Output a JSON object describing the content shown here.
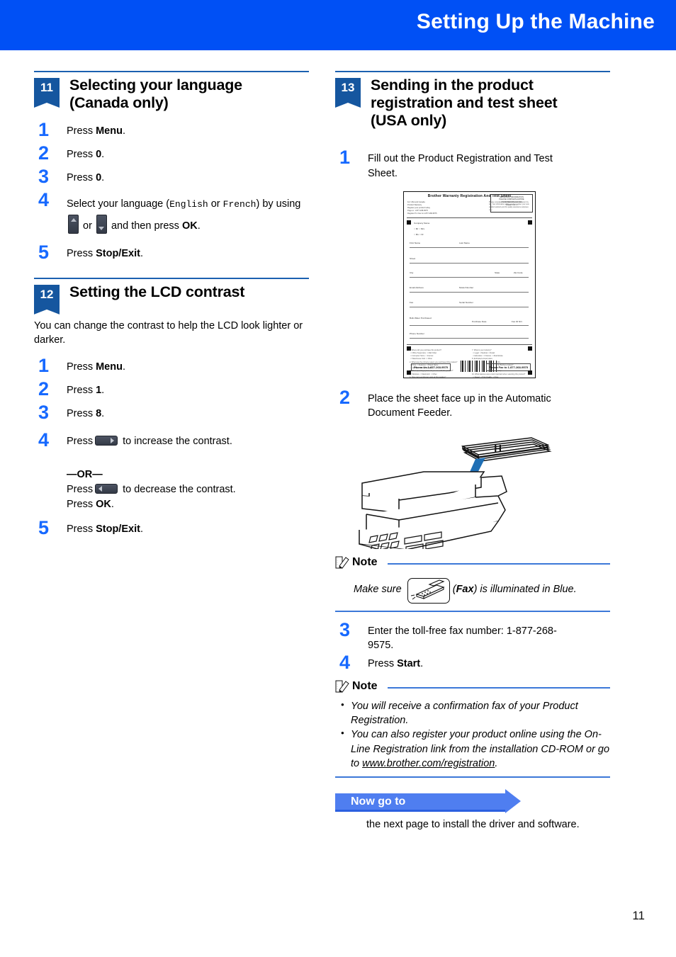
{
  "header": {
    "title": "Setting Up the Machine"
  },
  "page_number": "11",
  "left_column": {
    "sections": [
      {
        "number": "11",
        "title_line1": "Selecting your language",
        "title_line2": "(Canada only)",
        "steps": [
          {
            "num": "1",
            "text_before": "Press ",
            "bold": "Menu",
            "text_after": "."
          },
          {
            "num": "2",
            "text_before": "Press ",
            "bold": "0",
            "text_after": "."
          },
          {
            "num": "3",
            "text_before": "Press ",
            "bold": "0",
            "text_after": "."
          },
          {
            "num": "4",
            "part1": "Select your language (",
            "mono1": "English",
            "part2": " or ",
            "mono2": "French",
            "part3": ") by using ",
            "icon_up": "up-arrow-key",
            "part4": " or ",
            "icon_down": "down-arrow-key",
            "part5": " and then press ",
            "bold": "OK",
            "part6": "."
          },
          {
            "num": "5",
            "text_before": "Press ",
            "bold": "Stop/Exit",
            "text_after": "."
          }
        ]
      },
      {
        "number": "12",
        "title_line1": "Setting the LCD contrast",
        "title_line2": "",
        "intro": "You can change the contrast to help the LCD look lighter or darker.",
        "steps": [
          {
            "num": "1",
            "text_before": "Press ",
            "bold": "Menu",
            "text_after": "."
          },
          {
            "num": "2",
            "text_before": "Press ",
            "bold": "1",
            "text_after": "."
          },
          {
            "num": "3",
            "text_before": "Press ",
            "bold": "8",
            "text_after": "."
          },
          {
            "num": "4",
            "press_label": "Press",
            "icon_right": "right-arrow-key",
            "increase_text": "to increase the contrast.",
            "or_label": "—OR—",
            "press_label2": "Press",
            "icon_left": "left-arrow-key",
            "decrease_text": "to decrease the contrast.",
            "press_ok_before": "Press ",
            "press_ok_bold": "OK",
            "press_ok_after": "."
          },
          {
            "num": "5",
            "text_before": "Press ",
            "bold": "Stop/Exit",
            "text_after": "."
          }
        ]
      }
    ]
  },
  "right_column": {
    "section": {
      "number": "13",
      "title_line1": "Sending in the product",
      "title_line2": "registration and test sheet",
      "title_line3": "(USA only)"
    },
    "steps": [
      {
        "num": "1",
        "text": "Fill out the Product Registration and Test Sheet."
      },
      {
        "num": "2",
        "text": "Place the sheet face up in the Automatic Document Feeder."
      },
      {
        "num": "3",
        "text": "Enter the toll-free fax number: 1-877-268-9575."
      },
      {
        "num": "4",
        "text_before": "Press ",
        "bold": "Start",
        "text_after": "."
      }
    ],
    "registration_form": {
      "title": "Brother Warranty Registration And Test Sheet",
      "phone_left": "Phone Us 1-877-268-9575",
      "phone_right": "Please Fax to 1-877-268-9575",
      "fields": [
        "First Name",
        "Last Name",
        "Street",
        "City",
        "State",
        "Zip Code",
        "Email Address",
        "Model Number",
        "Fax",
        "Serial Number",
        "Bulk Water Purchased",
        "Purchase Date",
        "Fax ID NO.",
        "Phone Number"
      ]
    },
    "note1": {
      "label": "Note",
      "text_before": "Make sure ",
      "icon": "fax-key-icon",
      "text_bold": "Fax",
      "text_after": ") is illuminated in Blue.",
      "paren_open": "("
    },
    "note2": {
      "label": "Note",
      "bullets": [
        "You will receive a confirmation fax of your Product Registration.",
        "You can also register your product online using the On-Line Registration link from the installation CD-ROM or go to ",
        "www.brother.com/registration"
      ]
    },
    "now_go_to": {
      "banner": "Now go to",
      "text": "the next page to install the driver and software."
    }
  },
  "colors": {
    "header_blue": "#0050f5",
    "badge_blue": "#15569f",
    "step_number_blue": "#1769ff",
    "rule_blue": "#1b60b0",
    "note_rule_blue": "#3c78d8",
    "banner_blue": "#4f7ef0"
  }
}
